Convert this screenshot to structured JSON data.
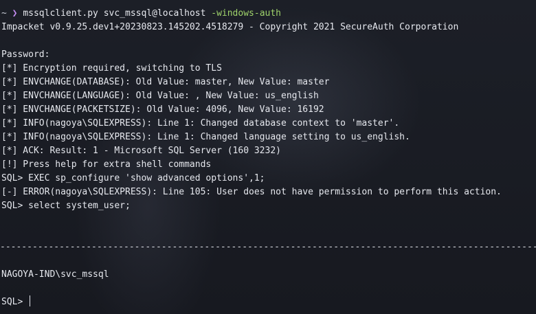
{
  "prompt": {
    "tilde": "~",
    "chevron": "❯",
    "command": "mssqlclient.py svc_mssql@localhost",
    "flag": "-windows-auth"
  },
  "output": [
    "Impacket v0.9.25.dev1+20230823.145202.4518279 - Copyright 2021 SecureAuth Corporation",
    "",
    "Password:",
    "[*] Encryption required, switching to TLS",
    "[*] ENVCHANGE(DATABASE): Old Value: master, New Value: master",
    "[*] ENVCHANGE(LANGUAGE): Old Value: , New Value: us_english",
    "[*] ENVCHANGE(PACKETSIZE): Old Value: 4096, New Value: 16192",
    "[*] INFO(nagoya\\SQLEXPRESS): Line 1: Changed database context to 'master'.",
    "[*] INFO(nagoya\\SQLEXPRESS): Line 1: Changed language setting to us_english.",
    "[*] ACK: Result: 1 - Microsoft SQL Server (160 3232)",
    "[!] Press help for extra shell commands",
    "SQL> EXEC sp_configure 'show advanced options',1;",
    "[-] ERROR(nagoya\\SQLEXPRESS): Line 105: User does not have permission to perform this action.",
    "SQL> select system_user;"
  ],
  "separator": "--------------------------------------------------------------------------------------------------------------",
  "result": "NAGOYA-IND\\svc_mssql",
  "sql_prompt": "SQL> "
}
